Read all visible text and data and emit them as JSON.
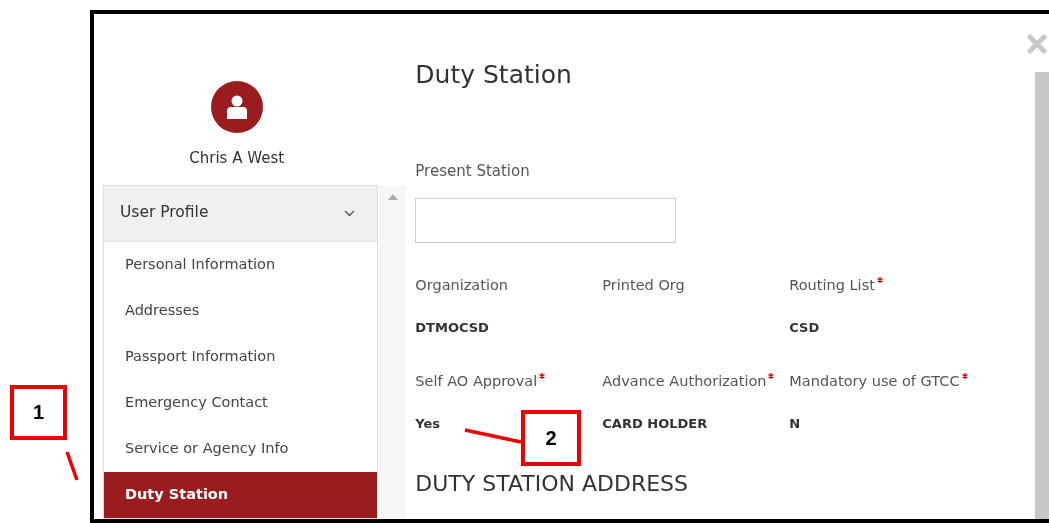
{
  "user": {
    "name": "Chris A West"
  },
  "menu": {
    "title": "User Profile",
    "expanded": true,
    "items": [
      {
        "label": "Personal Information",
        "selected": false
      },
      {
        "label": "Addresses",
        "selected": false
      },
      {
        "label": "Passport Information",
        "selected": false
      },
      {
        "label": "Emergency Contact",
        "selected": false
      },
      {
        "label": "Service or Agency Info",
        "selected": false
      },
      {
        "label": "Duty Station",
        "selected": true
      }
    ]
  },
  "page": {
    "title": "Duty Station",
    "present_station": {
      "label": "Present Station"
    },
    "fields": [
      {
        "label": "Organization",
        "required": false,
        "value": "DTMOCSD"
      },
      {
        "label": "Printed Org",
        "required": false
      },
      {
        "label": "Routing List",
        "required": true,
        "value": "CSD"
      },
      {
        "label": "Self AO Approval",
        "required": true,
        "value": "Yes"
      },
      {
        "label": "Advance Authorization",
        "required": true,
        "value": "CARD HOLDER"
      },
      {
        "label": "Mandatory use of GTCC",
        "required": true,
        "value": "N"
      }
    ],
    "section_heading": "DUTY STATION ADDRESS"
  },
  "callouts": [
    {
      "label": "1"
    },
    {
      "label": "2"
    }
  ]
}
